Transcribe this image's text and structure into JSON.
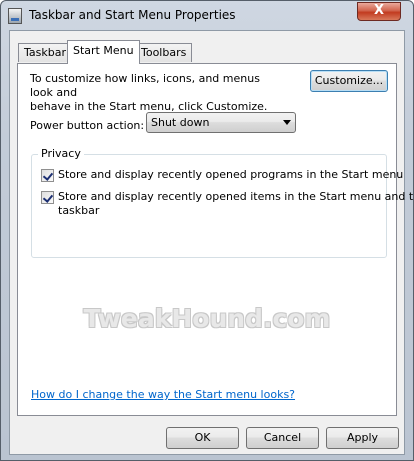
{
  "window": {
    "title": "Taskbar and Start Menu Properties",
    "close_label": "X"
  },
  "tabs": [
    {
      "label": "Taskbar",
      "active": false
    },
    {
      "label": "Start Menu",
      "active": true
    },
    {
      "label": "Toolbars",
      "active": false
    }
  ],
  "start_menu": {
    "description_line1": "To customize how links, icons, and menus look and",
    "description_line2": "behave in the Start menu, click Customize.",
    "customize_label": "Customize...",
    "power_button_label": "Power button action:",
    "power_button_value": "Shut down",
    "privacy": {
      "legend": "Privacy",
      "options": [
        {
          "line1": "Store and display recently opened programs in the Start menu",
          "line2": "",
          "checked": true
        },
        {
          "line1": "Store and display recently opened items in the Start menu and the",
          "line2": "taskbar",
          "checked": true
        }
      ]
    },
    "watermark": "TweakHound.com",
    "help_link": "How do I change the way the Start menu looks?"
  },
  "footer": {
    "ok_label": "OK",
    "cancel_label": "Cancel",
    "apply_label": "Apply"
  },
  "colors": {
    "link": "#0066cc",
    "close_button": "#c23b20",
    "dialog_face": "#f0f0f0"
  }
}
